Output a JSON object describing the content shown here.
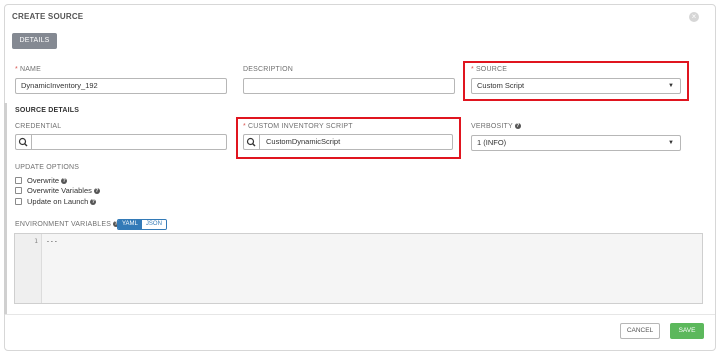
{
  "header": {
    "title": "CREATE SOURCE",
    "close_label": "×"
  },
  "tabs": {
    "details": "DETAILS"
  },
  "form": {
    "name_label": "NAME",
    "name_value": "DynamicInventory_192",
    "description_label": "DESCRIPTION",
    "description_value": "",
    "source_label": "SOURCE",
    "source_value": "Custom Script",
    "section_label": "SOURCE DETAILS",
    "credential_label": "CREDENTIAL",
    "credential_value": "",
    "script_label": "CUSTOM INVENTORY SCRIPT",
    "script_value": "CustomDynamicScript",
    "verbosity_label": "VERBOSITY",
    "verbosity_value": "1 (INFO)",
    "update_options_label": "UPDATE OPTIONS",
    "overwrite_label": "Overwrite",
    "overwrite_vars_label": "Overwrite Variables",
    "update_on_launch_label": "Update on Launch",
    "env_vars_label": "ENVIRONMENT VARIABLES",
    "yaml_label": "YAML",
    "json_label": "JSON",
    "editor_line": "1",
    "editor_code": "---",
    "required_mark": "*",
    "help_mark": "?"
  },
  "footer": {
    "cancel_label": "CANCEL",
    "save_label": "SAVE"
  },
  "colors": {
    "highlight": "#e0151f",
    "save": "#5cb85c",
    "toggle": "#337ab7",
    "tab": "#848992"
  }
}
